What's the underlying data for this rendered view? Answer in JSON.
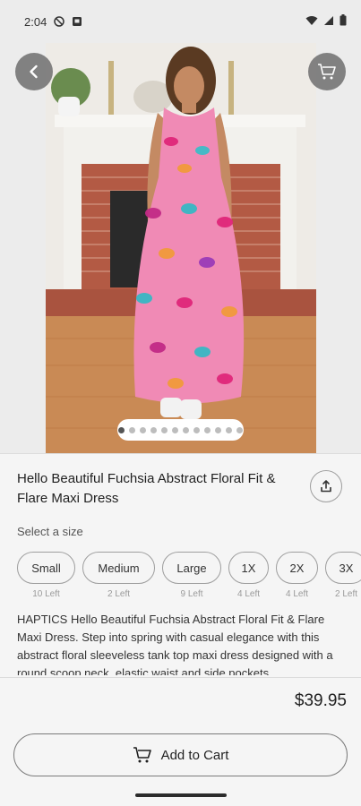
{
  "status_bar": {
    "time": "2:04",
    "icons": [
      "do-not-disturb-icon",
      "notification-icon",
      "wifi-icon",
      "signal-icon",
      "battery-icon"
    ]
  },
  "gallery": {
    "image_alt": "product-photo",
    "dot_count": 12,
    "active_dot": 0
  },
  "product": {
    "title": "Hello Beautiful Fuchsia Abstract Floral Fit & Flare Maxi Dress",
    "size_label": "Select a size",
    "sizes": [
      {
        "label": "Small",
        "left": "10 Left"
      },
      {
        "label": "Medium",
        "left": "2 Left"
      },
      {
        "label": "Large",
        "left": "9 Left"
      },
      {
        "label": "1X",
        "left": "4 Left"
      },
      {
        "label": "2X",
        "left": "4 Left"
      },
      {
        "label": "3X",
        "left": "2 Left"
      }
    ],
    "description": "HAPTICS Hello Beautiful Fuchsia Abstract Floral Fit & Flare Maxi Dress. Step into spring with casual elegance with this abstract floral sleeveless tank top maxi dress designed with a round scoop neck, elastic waist and side pockets.",
    "price": "$39.95"
  },
  "actions": {
    "add_to_cart": "Add to Cart"
  },
  "colors": {
    "background": "#f5f5f5",
    "overlay_button": "#6e6e6e",
    "border": "#9e9e9e"
  }
}
